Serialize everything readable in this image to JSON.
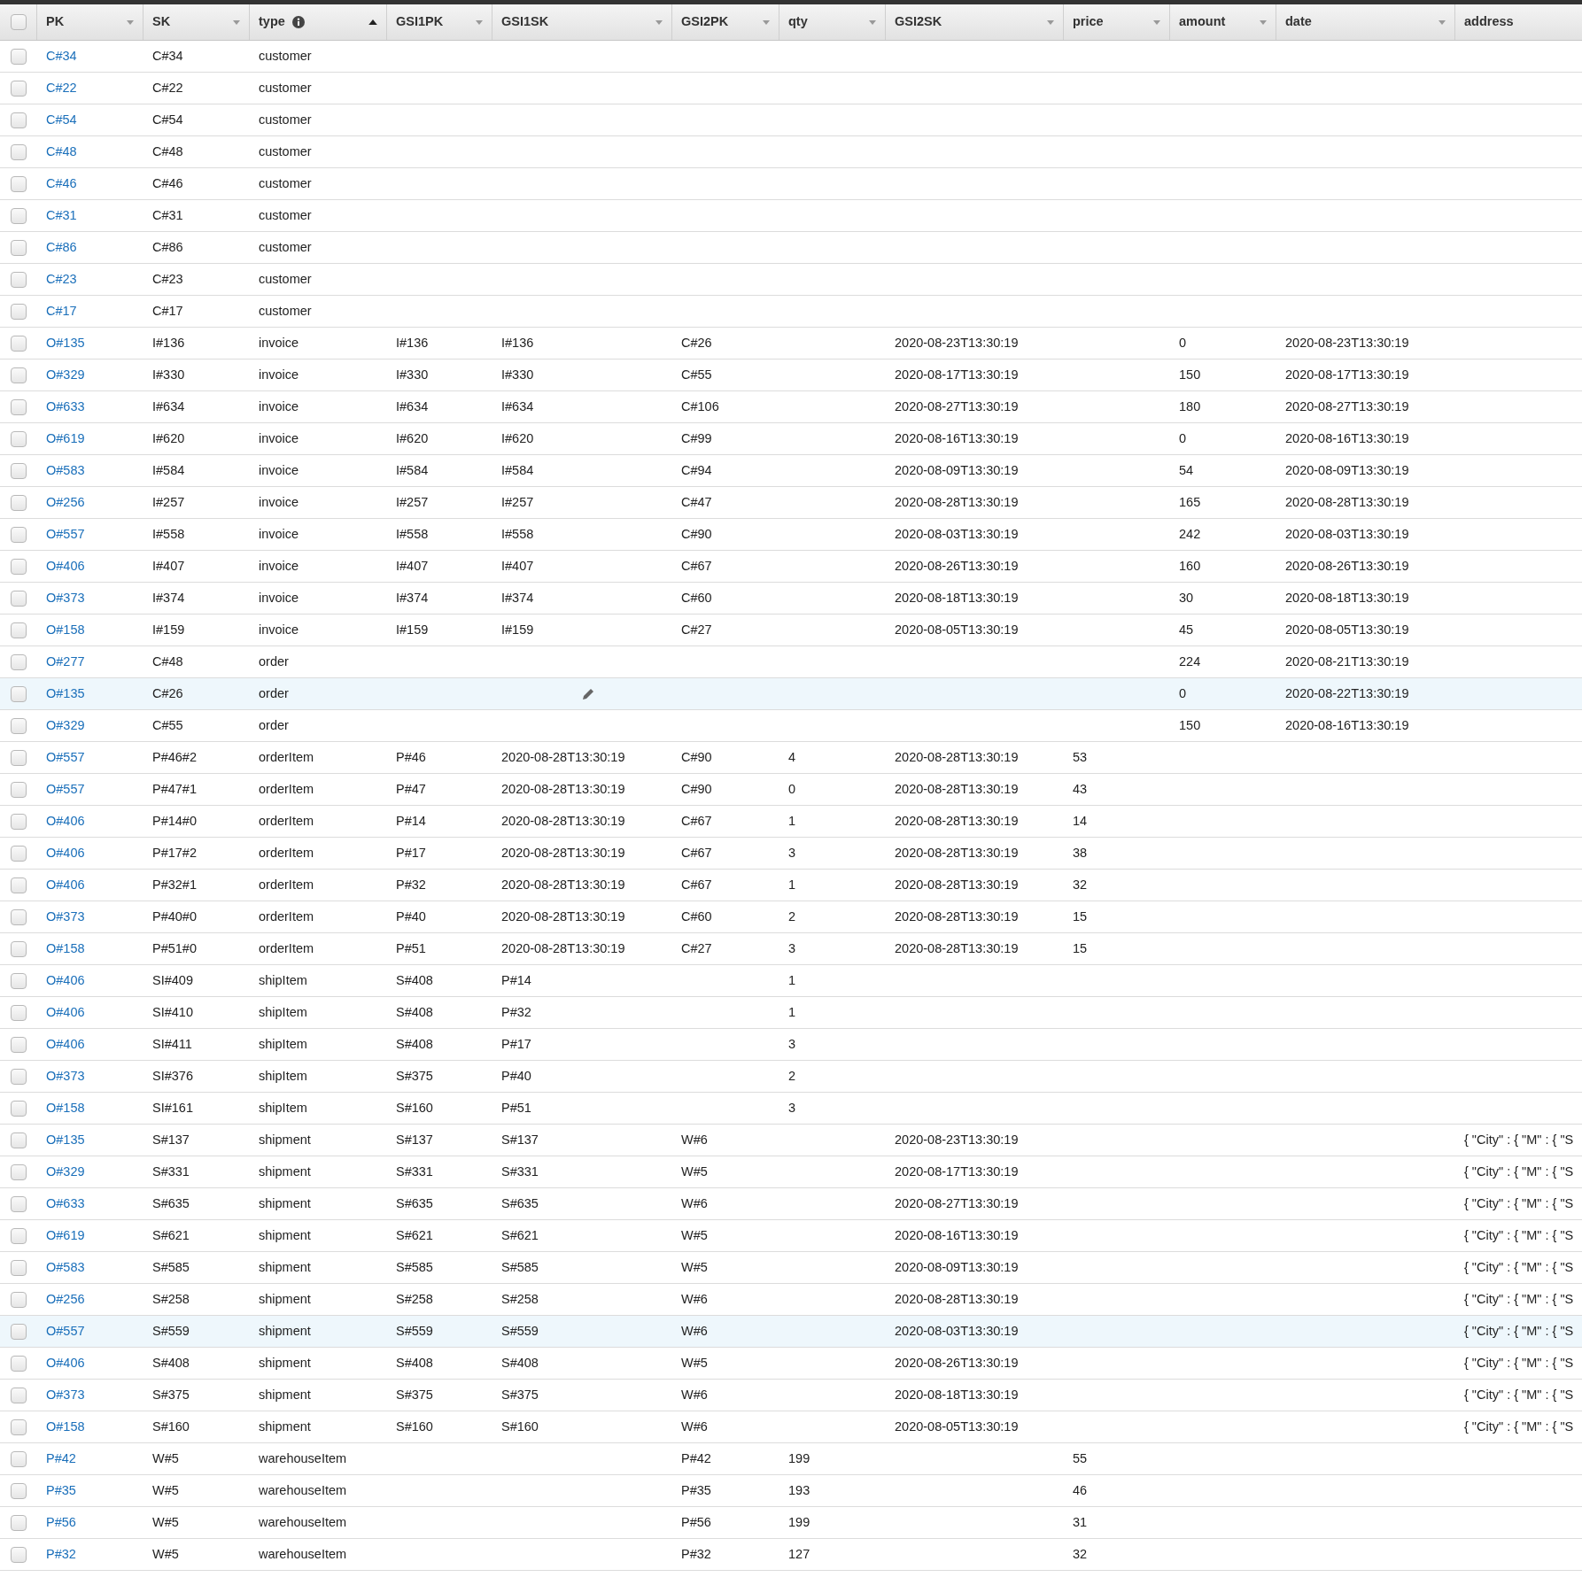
{
  "select_all_checked": false,
  "columns": [
    {
      "label": "PK",
      "sortable": true,
      "sorted_ascending": false,
      "info": false
    },
    {
      "label": "SK",
      "sortable": true,
      "sorted_ascending": false,
      "info": false
    },
    {
      "label": "type",
      "sortable": true,
      "sorted_ascending": true,
      "info": true
    },
    {
      "label": "GSI1PK",
      "sortable": true,
      "sorted_ascending": false,
      "info": false
    },
    {
      "label": "GSI1SK",
      "sortable": true,
      "sorted_ascending": false,
      "info": false
    },
    {
      "label": "GSI2PK",
      "sortable": true,
      "sorted_ascending": false,
      "info": false
    },
    {
      "label": "qty",
      "sortable": true,
      "sorted_ascending": false,
      "info": false
    },
    {
      "label": "GSI2SK",
      "sortable": true,
      "sorted_ascending": false,
      "info": false
    },
    {
      "label": "price",
      "sortable": true,
      "sorted_ascending": false,
      "info": false
    },
    {
      "label": "amount",
      "sortable": true,
      "sorted_ascending": false,
      "info": false
    },
    {
      "label": "date",
      "sortable": true,
      "sorted_ascending": false,
      "info": false
    },
    {
      "label": "address",
      "sortable": false,
      "info": false
    }
  ],
  "rows": [
    {
      "checked": false,
      "highlighted": false,
      "pencil": false,
      "cells": [
        "C#34",
        "C#34",
        "customer",
        null,
        null,
        null,
        null,
        null,
        null,
        null,
        null,
        null
      ]
    },
    {
      "checked": false,
      "highlighted": false,
      "pencil": false,
      "cells": [
        "C#22",
        "C#22",
        "customer",
        null,
        null,
        null,
        null,
        null,
        null,
        null,
        null,
        null
      ]
    },
    {
      "checked": false,
      "highlighted": false,
      "pencil": false,
      "cells": [
        "C#54",
        "C#54",
        "customer",
        null,
        null,
        null,
        null,
        null,
        null,
        null,
        null,
        null
      ]
    },
    {
      "checked": false,
      "highlighted": false,
      "pencil": false,
      "cells": [
        "C#48",
        "C#48",
        "customer",
        null,
        null,
        null,
        null,
        null,
        null,
        null,
        null,
        null
      ]
    },
    {
      "checked": false,
      "highlighted": false,
      "pencil": false,
      "cells": [
        "C#46",
        "C#46",
        "customer",
        null,
        null,
        null,
        null,
        null,
        null,
        null,
        null,
        null
      ]
    },
    {
      "checked": false,
      "highlighted": false,
      "pencil": false,
      "cells": [
        "C#31",
        "C#31",
        "customer",
        null,
        null,
        null,
        null,
        null,
        null,
        null,
        null,
        null
      ]
    },
    {
      "checked": false,
      "highlighted": false,
      "pencil": false,
      "cells": [
        "C#86",
        "C#86",
        "customer",
        null,
        null,
        null,
        null,
        null,
        null,
        null,
        null,
        null
      ]
    },
    {
      "checked": false,
      "highlighted": false,
      "pencil": false,
      "cells": [
        "C#23",
        "C#23",
        "customer",
        null,
        null,
        null,
        null,
        null,
        null,
        null,
        null,
        null
      ]
    },
    {
      "checked": false,
      "highlighted": false,
      "pencil": false,
      "cells": [
        "C#17",
        "C#17",
        "customer",
        null,
        null,
        null,
        null,
        null,
        null,
        null,
        null,
        null
      ]
    },
    {
      "checked": false,
      "highlighted": false,
      "pencil": false,
      "cells": [
        "O#135",
        "I#136",
        "invoice",
        "I#136",
        "I#136",
        "C#26",
        null,
        "2020-08-23T13:30:19",
        null,
        "0",
        "2020-08-23T13:30:19",
        null
      ]
    },
    {
      "checked": false,
      "highlighted": false,
      "pencil": false,
      "cells": [
        "O#329",
        "I#330",
        "invoice",
        "I#330",
        "I#330",
        "C#55",
        null,
        "2020-08-17T13:30:19",
        null,
        "150",
        "2020-08-17T13:30:19",
        null
      ]
    },
    {
      "checked": false,
      "highlighted": false,
      "pencil": false,
      "cells": [
        "O#633",
        "I#634",
        "invoice",
        "I#634",
        "I#634",
        "C#106",
        null,
        "2020-08-27T13:30:19",
        null,
        "180",
        "2020-08-27T13:30:19",
        null
      ]
    },
    {
      "checked": false,
      "highlighted": false,
      "pencil": false,
      "cells": [
        "O#619",
        "I#620",
        "invoice",
        "I#620",
        "I#620",
        "C#99",
        null,
        "2020-08-16T13:30:19",
        null,
        "0",
        "2020-08-16T13:30:19",
        null
      ]
    },
    {
      "checked": false,
      "highlighted": false,
      "pencil": false,
      "cells": [
        "O#583",
        "I#584",
        "invoice",
        "I#584",
        "I#584",
        "C#94",
        null,
        "2020-08-09T13:30:19",
        null,
        "54",
        "2020-08-09T13:30:19",
        null
      ]
    },
    {
      "checked": false,
      "highlighted": false,
      "pencil": false,
      "cells": [
        "O#256",
        "I#257",
        "invoice",
        "I#257",
        "I#257",
        "C#47",
        null,
        "2020-08-28T13:30:19",
        null,
        "165",
        "2020-08-28T13:30:19",
        null
      ]
    },
    {
      "checked": false,
      "highlighted": false,
      "pencil": false,
      "cells": [
        "O#557",
        "I#558",
        "invoice",
        "I#558",
        "I#558",
        "C#90",
        null,
        "2020-08-03T13:30:19",
        null,
        "242",
        "2020-08-03T13:30:19",
        null
      ]
    },
    {
      "checked": false,
      "highlighted": false,
      "pencil": false,
      "cells": [
        "O#406",
        "I#407",
        "invoice",
        "I#407",
        "I#407",
        "C#67",
        null,
        "2020-08-26T13:30:19",
        null,
        "160",
        "2020-08-26T13:30:19",
        null
      ]
    },
    {
      "checked": false,
      "highlighted": false,
      "pencil": false,
      "cells": [
        "O#373",
        "I#374",
        "invoice",
        "I#374",
        "I#374",
        "C#60",
        null,
        "2020-08-18T13:30:19",
        null,
        "30",
        "2020-08-18T13:30:19",
        null
      ]
    },
    {
      "checked": false,
      "highlighted": false,
      "pencil": false,
      "cells": [
        "O#158",
        "I#159",
        "invoice",
        "I#159",
        "I#159",
        "C#27",
        null,
        "2020-08-05T13:30:19",
        null,
        "45",
        "2020-08-05T13:30:19",
        null
      ]
    },
    {
      "checked": false,
      "highlighted": false,
      "pencil": false,
      "cells": [
        "O#277",
        "C#48",
        "order",
        null,
        null,
        null,
        null,
        null,
        null,
        "224",
        "2020-08-21T13:30:19",
        null
      ]
    },
    {
      "checked": false,
      "highlighted": true,
      "pencil": true,
      "cells": [
        "O#135",
        "C#26",
        "order",
        null,
        null,
        null,
        null,
        null,
        null,
        "0",
        "2020-08-22T13:30:19",
        null
      ]
    },
    {
      "checked": false,
      "highlighted": false,
      "pencil": false,
      "cells": [
        "O#329",
        "C#55",
        "order",
        null,
        null,
        null,
        null,
        null,
        null,
        "150",
        "2020-08-16T13:30:19",
        null
      ]
    },
    {
      "checked": false,
      "highlighted": false,
      "pencil": false,
      "cells": [
        "O#557",
        "P#46#2",
        "orderItem",
        "P#46",
        "2020-08-28T13:30:19",
        "C#90",
        "4",
        "2020-08-28T13:30:19",
        "53",
        null,
        null,
        null
      ]
    },
    {
      "checked": false,
      "highlighted": false,
      "pencil": false,
      "cells": [
        "O#557",
        "P#47#1",
        "orderItem",
        "P#47",
        "2020-08-28T13:30:19",
        "C#90",
        "0",
        "2020-08-28T13:30:19",
        "43",
        null,
        null,
        null
      ]
    },
    {
      "checked": false,
      "highlighted": false,
      "pencil": false,
      "cells": [
        "O#406",
        "P#14#0",
        "orderItem",
        "P#14",
        "2020-08-28T13:30:19",
        "C#67",
        "1",
        "2020-08-28T13:30:19",
        "14",
        null,
        null,
        null
      ]
    },
    {
      "checked": false,
      "highlighted": false,
      "pencil": false,
      "cells": [
        "O#406",
        "P#17#2",
        "orderItem",
        "P#17",
        "2020-08-28T13:30:19",
        "C#67",
        "3",
        "2020-08-28T13:30:19",
        "38",
        null,
        null,
        null
      ]
    },
    {
      "checked": false,
      "highlighted": false,
      "pencil": false,
      "cells": [
        "O#406",
        "P#32#1",
        "orderItem",
        "P#32",
        "2020-08-28T13:30:19",
        "C#67",
        "1",
        "2020-08-28T13:30:19",
        "32",
        null,
        null,
        null
      ]
    },
    {
      "checked": false,
      "highlighted": false,
      "pencil": false,
      "cells": [
        "O#373",
        "P#40#0",
        "orderItem",
        "P#40",
        "2020-08-28T13:30:19",
        "C#60",
        "2",
        "2020-08-28T13:30:19",
        "15",
        null,
        null,
        null
      ]
    },
    {
      "checked": false,
      "highlighted": false,
      "pencil": false,
      "cells": [
        "O#158",
        "P#51#0",
        "orderItem",
        "P#51",
        "2020-08-28T13:30:19",
        "C#27",
        "3",
        "2020-08-28T13:30:19",
        "15",
        null,
        null,
        null
      ]
    },
    {
      "checked": false,
      "highlighted": false,
      "pencil": false,
      "cells": [
        "O#406",
        "SI#409",
        "shipItem",
        "S#408",
        "P#14",
        null,
        "1",
        null,
        null,
        null,
        null,
        null
      ]
    },
    {
      "checked": false,
      "highlighted": false,
      "pencil": false,
      "cells": [
        "O#406",
        "SI#410",
        "shipItem",
        "S#408",
        "P#32",
        null,
        "1",
        null,
        null,
        null,
        null,
        null
      ]
    },
    {
      "checked": false,
      "highlighted": false,
      "pencil": false,
      "cells": [
        "O#406",
        "SI#411",
        "shipItem",
        "S#408",
        "P#17",
        null,
        "3",
        null,
        null,
        null,
        null,
        null
      ]
    },
    {
      "checked": false,
      "highlighted": false,
      "pencil": false,
      "cells": [
        "O#373",
        "SI#376",
        "shipItem",
        "S#375",
        "P#40",
        null,
        "2",
        null,
        null,
        null,
        null,
        null
      ]
    },
    {
      "checked": false,
      "highlighted": false,
      "pencil": false,
      "cells": [
        "O#158",
        "SI#161",
        "shipItem",
        "S#160",
        "P#51",
        null,
        "3",
        null,
        null,
        null,
        null,
        null
      ]
    },
    {
      "checked": false,
      "highlighted": false,
      "pencil": false,
      "cells": [
        "O#135",
        "S#137",
        "shipment",
        "S#137",
        "S#137",
        "W#6",
        null,
        "2020-08-23T13:30:19",
        null,
        null,
        null,
        "{ \"City\" : { \"M\" : { \"S"
      ]
    },
    {
      "checked": false,
      "highlighted": false,
      "pencil": false,
      "cells": [
        "O#329",
        "S#331",
        "shipment",
        "S#331",
        "S#331",
        "W#5",
        null,
        "2020-08-17T13:30:19",
        null,
        null,
        null,
        "{ \"City\" : { \"M\" : { \"S"
      ]
    },
    {
      "checked": false,
      "highlighted": false,
      "pencil": false,
      "cells": [
        "O#633",
        "S#635",
        "shipment",
        "S#635",
        "S#635",
        "W#6",
        null,
        "2020-08-27T13:30:19",
        null,
        null,
        null,
        "{ \"City\" : { \"M\" : { \"S"
      ]
    },
    {
      "checked": false,
      "highlighted": false,
      "pencil": false,
      "cells": [
        "O#619",
        "S#621",
        "shipment",
        "S#621",
        "S#621",
        "W#5",
        null,
        "2020-08-16T13:30:19",
        null,
        null,
        null,
        "{ \"City\" : { \"M\" : { \"S"
      ]
    },
    {
      "checked": false,
      "highlighted": false,
      "pencil": false,
      "cells": [
        "O#583",
        "S#585",
        "shipment",
        "S#585",
        "S#585",
        "W#5",
        null,
        "2020-08-09T13:30:19",
        null,
        null,
        null,
        "{ \"City\" : { \"M\" : { \"S"
      ]
    },
    {
      "checked": false,
      "highlighted": false,
      "pencil": false,
      "cells": [
        "O#256",
        "S#258",
        "shipment",
        "S#258",
        "S#258",
        "W#6",
        null,
        "2020-08-28T13:30:19",
        null,
        null,
        null,
        "{ \"City\" : { \"M\" : { \"S"
      ]
    },
    {
      "checked": false,
      "highlighted": true,
      "pencil": false,
      "cells": [
        "O#557",
        "S#559",
        "shipment",
        "S#559",
        "S#559",
        "W#6",
        null,
        "2020-08-03T13:30:19",
        null,
        null,
        null,
        "{ \"City\" : { \"M\" : { \"S"
      ]
    },
    {
      "checked": false,
      "highlighted": false,
      "pencil": false,
      "cells": [
        "O#406",
        "S#408",
        "shipment",
        "S#408",
        "S#408",
        "W#5",
        null,
        "2020-08-26T13:30:19",
        null,
        null,
        null,
        "{ \"City\" : { \"M\" : { \"S"
      ]
    },
    {
      "checked": false,
      "highlighted": false,
      "pencil": false,
      "cells": [
        "O#373",
        "S#375",
        "shipment",
        "S#375",
        "S#375",
        "W#6",
        null,
        "2020-08-18T13:30:19",
        null,
        null,
        null,
        "{ \"City\" : { \"M\" : { \"S"
      ]
    },
    {
      "checked": false,
      "highlighted": false,
      "pencil": false,
      "cells": [
        "O#158",
        "S#160",
        "shipment",
        "S#160",
        "S#160",
        "W#6",
        null,
        "2020-08-05T13:30:19",
        null,
        null,
        null,
        "{ \"City\" : { \"M\" : { \"S"
      ]
    },
    {
      "checked": false,
      "highlighted": false,
      "pencil": false,
      "cells": [
        "P#42",
        "W#5",
        "warehouseItem",
        null,
        null,
        "P#42",
        "199",
        null,
        "55",
        null,
        null,
        null
      ]
    },
    {
      "checked": false,
      "highlighted": false,
      "pencil": false,
      "cells": [
        "P#35",
        "W#5",
        "warehouseItem",
        null,
        null,
        "P#35",
        "193",
        null,
        "46",
        null,
        null,
        null
      ]
    },
    {
      "checked": false,
      "highlighted": false,
      "pencil": false,
      "cells": [
        "P#56",
        "W#5",
        "warehouseItem",
        null,
        null,
        "P#56",
        "199",
        null,
        "31",
        null,
        null,
        null
      ]
    },
    {
      "checked": false,
      "highlighted": false,
      "pencil": false,
      "cells": [
        "P#32",
        "W#5",
        "warehouseItem",
        null,
        null,
        "P#32",
        "127",
        null,
        "32",
        null,
        null,
        null
      ]
    }
  ]
}
